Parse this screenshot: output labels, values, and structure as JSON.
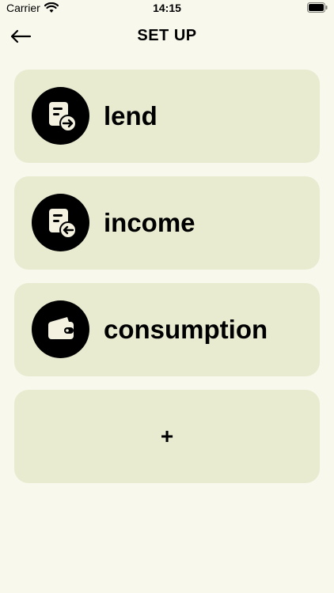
{
  "status_bar": {
    "carrier": "Carrier",
    "time": "14:15",
    "icons": [
      "wifi-icon",
      "battery-icon"
    ]
  },
  "nav": {
    "back_icon": "arrow-left-icon",
    "title": "SET UP"
  },
  "categories": [
    {
      "label": "lend",
      "icon": "document-arrow-right-icon"
    },
    {
      "label": "income",
      "icon": "document-arrow-left-icon"
    },
    {
      "label": "consumption",
      "icon": "wallet-icon"
    }
  ],
  "add_button": {
    "label": "+"
  },
  "colors": {
    "background": "#f8f8ec",
    "card": "#e8ebd0",
    "icon_circle": "#000000",
    "icon_glyph": "#f4f1e0"
  }
}
